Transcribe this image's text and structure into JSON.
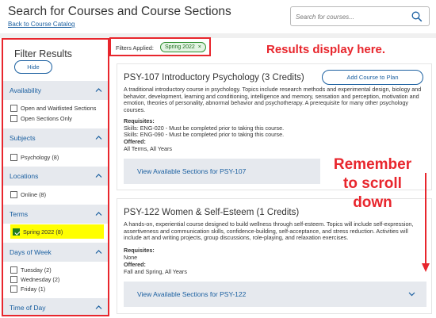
{
  "header": {
    "title": "Search for Courses and Course Sections",
    "back_link": "Back to Course Catalog",
    "search_placeholder": "Search for courses..."
  },
  "filters": {
    "title": "Filter Results",
    "hide_label": "Hide",
    "availability": {
      "label": "Availability",
      "options": [
        "Open and Waitlisted Sections",
        "Open Sections Only"
      ]
    },
    "subjects": {
      "label": "Subjects",
      "options": [
        "Psychology (8)"
      ]
    },
    "locations": {
      "label": "Locations",
      "options": [
        "Online (8)"
      ]
    },
    "terms": {
      "label": "Terms",
      "options": [
        "Spring 2022 (8)"
      ],
      "checked": "Spring 2022 (8)"
    },
    "days": {
      "label": "Days of Week",
      "options": [
        "Tuesday (2)",
        "Wednesday (2)",
        "Friday (1)"
      ]
    },
    "time": {
      "label": "Time of Day"
    }
  },
  "applied": {
    "label": "Filters Applied:",
    "chip": "Spring 2022",
    "chip_remove": "×"
  },
  "annotations": {
    "results": "Results display here.",
    "remember": [
      "Remember",
      "to scroll",
      "down"
    ]
  },
  "courses": [
    {
      "title": "PSY-107 Introductory Psychology (3 Credits)",
      "add_label": "Add Course to Plan",
      "description": "A traditional introductory course in psychology. Topics include research methods and experimental design, biology and behavior, development, learning and conditioning, intelligence and memory, sensation and perception, motivation and emotion, theories of personality, abnormal behavior and psychotherapy. A prerequisite for many other psychology courses.",
      "requisites_label": "Requisites:",
      "requisites": [
        "Skills: ENG-020 - Must be completed prior to taking this course.",
        "Skills: ENG-090 - Must be completed prior to taking this course."
      ],
      "offered_label": "Offered:",
      "offered": "All Terms, All Years",
      "sections_label": "View Available Sections for PSY-107"
    },
    {
      "title": "PSY-122 Women & Self-Esteem (1 Credits)",
      "description": "A hands-on, experiential course designed to build wellness through self-esteem. Topics will include self-expression, assertiveness and communication skills, confidence-building, self-acceptance, and stress reduction. Activities will include art and writing projects, group discussions, role-playing, and relaxation exercises.",
      "requisites_label": "Requisites:",
      "requisites": [
        "None"
      ],
      "offered_label": "Offered:",
      "offered": "Fall and Spring, All Years",
      "sections_label": "View Available Sections for PSY-122"
    }
  ],
  "colors": {
    "accent": "#1a5fa0",
    "annotation": "#e8262d",
    "highlight": "#ffff00",
    "check": "#1e7d1e"
  }
}
